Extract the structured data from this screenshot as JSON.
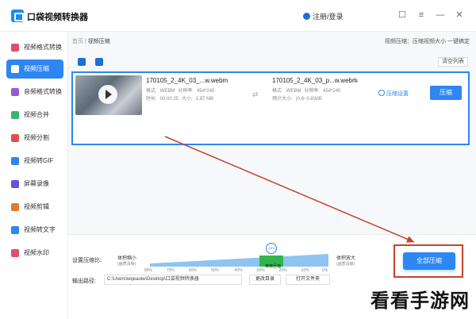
{
  "app": {
    "title": "口袋视频转换器",
    "login": "注册/登录"
  },
  "window_controls": {
    "minimize": "—",
    "menu": "≡",
    "close": "✕",
    "file": "☐"
  },
  "sidebar": {
    "items": [
      {
        "label": "视频格式转换"
      },
      {
        "label": "视频压缩"
      },
      {
        "label": "音频格式转换"
      },
      {
        "label": "视频合并"
      },
      {
        "label": "视频分割"
      },
      {
        "label": "视频转GIF"
      },
      {
        "label": "屏幕录像"
      },
      {
        "label": "视频剪辑"
      },
      {
        "label": "视频转文字"
      },
      {
        "label": "视频水印"
      }
    ],
    "active_index": 1
  },
  "breadcrumb": {
    "home": "首页",
    "sep": " | ",
    "current": "视频压缩"
  },
  "top_right_hint": "视频压缩：压缩视频大小 一键搞定",
  "toolbar": {
    "clear_label": "清空列表"
  },
  "file": {
    "source": {
      "name": "170105_2_4K_03_...w.webm",
      "format_label": "格式:",
      "format": "WEBM",
      "res_label": "分辨率:",
      "resolution": "454*240",
      "duration_label": "时长:",
      "duration": "00:00:25",
      "size_label": "大小:",
      "size": "1.87 MB"
    },
    "target": {
      "name": "170105_2_4K_03_p...w.webm",
      "format_label": "格式:",
      "format": "WEBM",
      "res_label": "分辨率:",
      "resolution": "454*240",
      "est_label": "预计大小:",
      "est_size": "(0.8~0.8)MB"
    },
    "settings_label": "压缩设置",
    "compress_label": "压缩"
  },
  "bottom": {
    "ratio_label": "设置压缩比:",
    "small_label": "体积缩小",
    "small_sub": "(画质清晰)",
    "large_label": "体积放大",
    "large_sub": "(画质清晰)",
    "slider_value_label": "-20%",
    "recommended_label": "推荐压缩",
    "ticks": [
      "80%",
      "70%",
      "60%",
      "50%",
      "-40%",
      "-30%",
      "-20%",
      "-10%",
      "0%"
    ],
    "slider_level": 0.68,
    "path_label": "输出路径:",
    "path_value": "C:\\Users\\wqeaoiw\\Desktop\\口袋视频转换器",
    "change_dir_label": "更改目录",
    "open_folder_label": "打开文件夹",
    "compress_all_label": "全部压缩"
  },
  "watermark": "看看手游网",
  "colors": {
    "accent": "#2d86f2",
    "annotation": "#c6432b",
    "green": "#2fb64c"
  }
}
